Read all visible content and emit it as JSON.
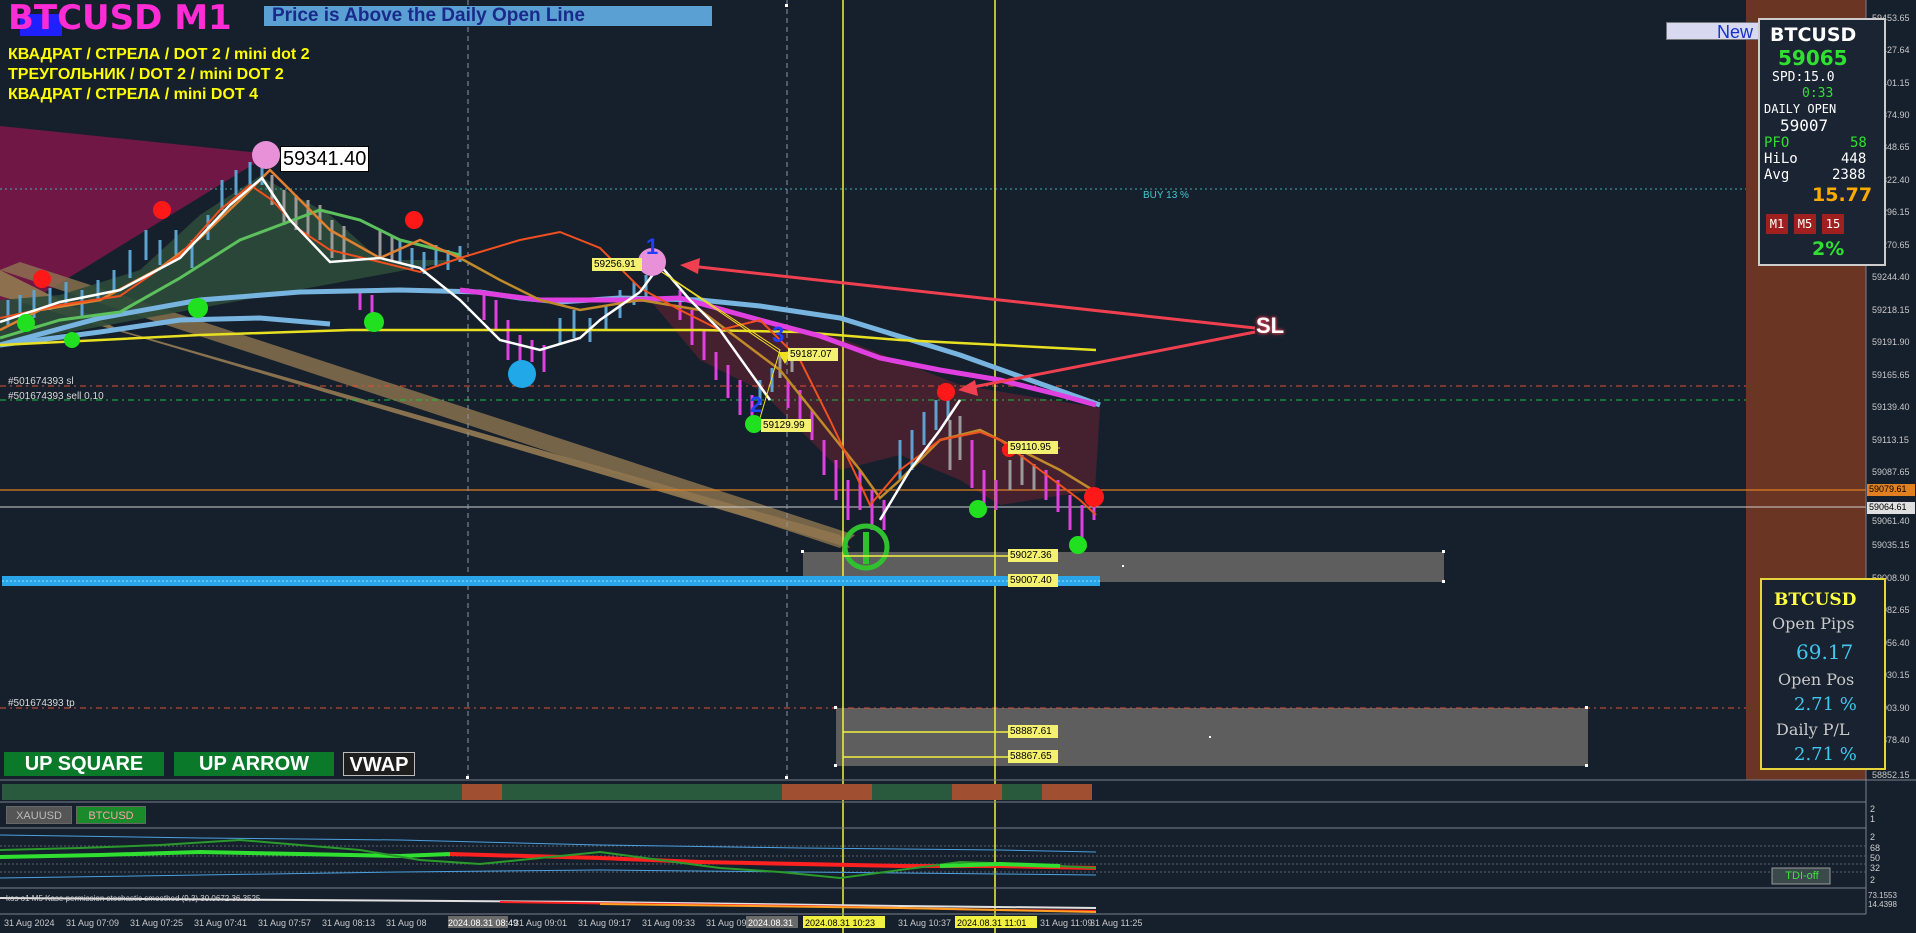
{
  "window": {
    "title": "BTCUSD M1",
    "banner": "Price is Above the Daily Open Line",
    "new_button": "New"
  },
  "notes": [
    "КВАДРАТ / СТРЕЛА / DOT 2 / mini dot 2",
    "ТРЕУГОЛЬНИК / DOT 2 / mini DOT 2",
    "КВАДРАТ / СТРЕЛА /  mini DOT 4"
  ],
  "chart": {
    "high_label": "59341.40",
    "sl_label": "SL",
    "buy_label": "BUY 13 %",
    "order_sl": "#501674393 sl",
    "order_sell": "#501674393 sell 0.10",
    "order_tp": "#501674393 tp",
    "wave_labels": [
      "1",
      "2",
      "3"
    ],
    "price_tags": [
      "59256.91",
      "59187.07",
      "59129.99",
      "59110.95",
      "59027.36",
      "59007.40",
      "58887.61",
      "58867.65"
    ],
    "current_price_tags": {
      "orange": "59079.61",
      "white": "59064.61"
    }
  },
  "price_axis": [
    "59453.65",
    "59427.64",
    "59401.15",
    "59374.90",
    "59348.65",
    "59322.40",
    "59296.15",
    "59270.65",
    "59244.40",
    "59218.15",
    "59191.90",
    "59165.65",
    "59139.40",
    "59113.15",
    "59087.65",
    "59061.40",
    "59035.15",
    "59008.90",
    "58982.65",
    "58956.40",
    "58930.15",
    "58903.90",
    "58878.40",
    "58852.15"
  ],
  "time_axis": [
    "31 Aug 2024",
    "31 Aug 07:09",
    "31 Aug 07:25",
    "31 Aug 07:41",
    "31 Aug 07:57",
    "31 Aug 08:13",
    "31 Aug 08",
    "2024.08.31 08:49",
    "31 Aug 09:01",
    "31 Aug 09:17",
    "31 Aug 09:33",
    "31 Aug 09",
    "2024.08.31",
    "2024.08.31 10:23",
    "31 Aug 10:37",
    "2024.08.31 11:01",
    "31 Aug 11:09",
    "31 Aug 11:25"
  ],
  "buttons": {
    "up_square": "UP SQUARE",
    "up_arrow": "UP ARROW",
    "vwap": "VWAP"
  },
  "symbols": [
    "XAUUSD",
    "BTCUSD"
  ],
  "info_panel": {
    "symbol": "BTCUSD",
    "price": "59065",
    "spread": "SPD:15.0",
    "timer": "0:33",
    "daily_open_label": "DAILY OPEN",
    "daily_open": "59007",
    "pfo_label": "PFO",
    "pfo": "58",
    "hilo_label": "HiLo",
    "hilo": "448",
    "avg_label": "Avg",
    "avg": "2388",
    "value": "15.77",
    "timeframes": [
      "M1",
      "M5",
      "15"
    ],
    "percent": "2%"
  },
  "pips_panel": {
    "symbol": "BTCUSD",
    "open_pips_label": "Open Pips",
    "open_pips": "69.17",
    "open_pos_label": "Open Pos",
    "open_pos": "2.71 %",
    "daily_pl_label": "Daily P/L",
    "daily_pl": "2.71 %"
  },
  "indicator": {
    "tdi_button": "TDI-off",
    "levels": [
      "2",
      "68",
      "50",
      "32",
      "2"
    ],
    "stoch_title": "kos o1 M5 Kase permission stochastic smoothed (9,3) 30.0672 36.3525",
    "stoch_levels": [
      "73.1553",
      "14.4398"
    ],
    "strip_levels": [
      "2",
      "1"
    ]
  },
  "colors": {
    "background": "#16202c",
    "right_bar": "#6b3524",
    "title": "#ff2bd4",
    "note": "#ffff00",
    "green": "#22cc22",
    "magenta": "#e040e0",
    "sl_arrow": "#f04050"
  }
}
